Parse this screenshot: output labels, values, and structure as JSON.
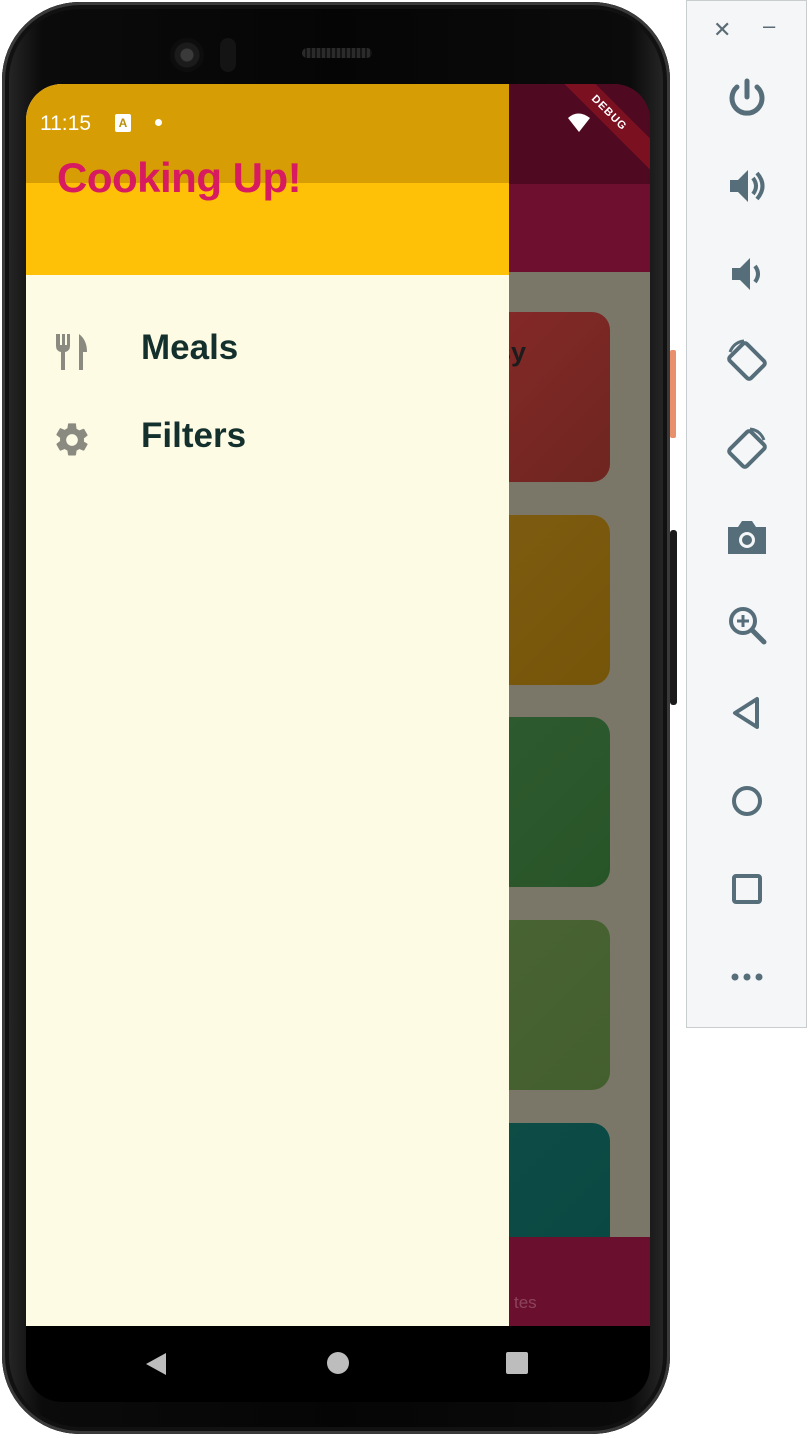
{
  "status_bar": {
    "time": "11:15",
    "a_badge": "A"
  },
  "drawer": {
    "title": "Cooking Up!",
    "items": [
      {
        "label": "Meals",
        "icon": "fork-knife-icon"
      },
      {
        "label": "Filters",
        "icon": "gear-icon"
      }
    ]
  },
  "background_app": {
    "category_title_partial": "asy",
    "bottom_nav_label_partial": "tes",
    "debug_banner": "DEBUG"
  },
  "emulator_controls": {
    "icons": [
      "close-icon",
      "minimize-icon",
      "power-icon",
      "volume-up-icon",
      "volume-down-icon",
      "rotate-left-icon",
      "rotate-right-icon",
      "camera-icon",
      "zoom-icon",
      "back-icon",
      "home-icon",
      "overview-icon",
      "more-icon"
    ]
  },
  "colors": {
    "drawer_header": "#ffc107",
    "drawer_title": "#d81b60",
    "drawer_body": "#fdfbe4",
    "app_primary": "#6e0f2f"
  }
}
